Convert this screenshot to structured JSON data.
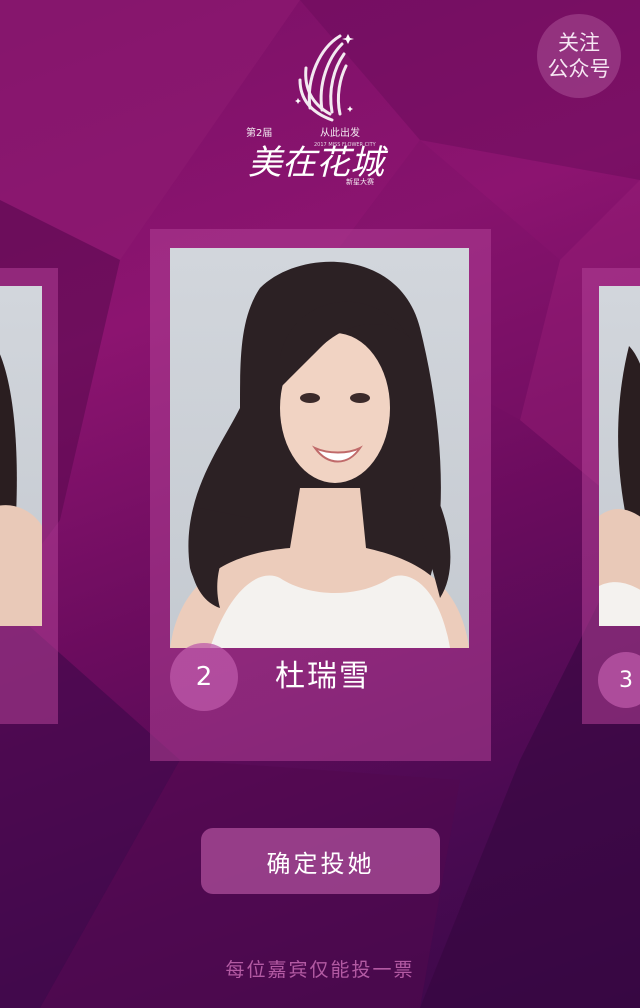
{
  "header": {
    "follow_label_line1": "关注",
    "follow_label_line2": "公众号"
  },
  "logo": {
    "edition": "第2届",
    "tagline": "从此出发",
    "title": "美在花城",
    "subtitle_en": "2017 MISS FLOWER CITY",
    "badge": "新星大赛"
  },
  "contestants": [
    {
      "number": "2",
      "name": "杜瑞雪",
      "position": "center"
    },
    {
      "number": "3",
      "name": "",
      "position": "right"
    }
  ],
  "actions": {
    "vote_label": "确定投她"
  },
  "footer": {
    "notice": "每位嘉宾仅能投一票"
  },
  "colors": {
    "background": "#7a1066",
    "card": "#b04096",
    "accent_text": "#b35aa3"
  }
}
